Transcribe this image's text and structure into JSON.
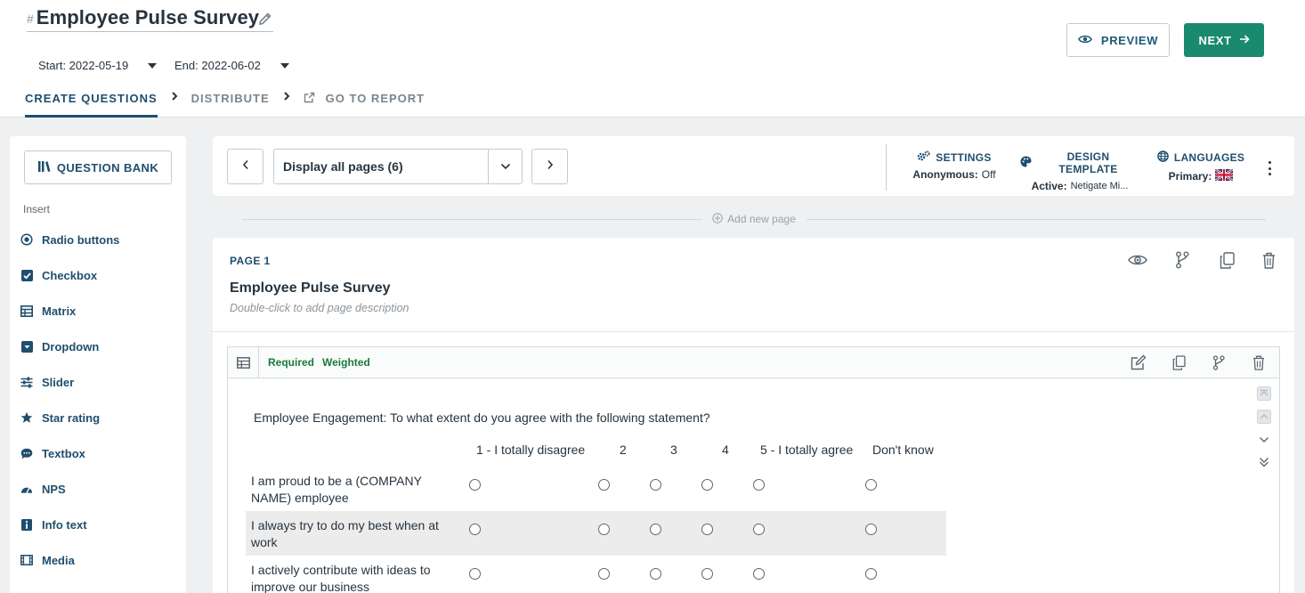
{
  "survey": {
    "hash": "#",
    "title": "Employee Pulse Survey"
  },
  "dates": {
    "start": "Start: 2022-05-19",
    "end": "End: 2022-06-02"
  },
  "actions": {
    "preview": "PREVIEW",
    "next": "NEXT"
  },
  "steps": [
    "CREATE QUESTIONS",
    "DISTRIBUTE",
    "GO TO REPORT"
  ],
  "left_panel": {
    "question_bank": "QUESTION BANK",
    "insert_label": "Insert",
    "items": [
      {
        "label": "Radio buttons",
        "icon": "radio-icon"
      },
      {
        "label": "Checkbox",
        "icon": "checkbox-icon"
      },
      {
        "label": "Matrix",
        "icon": "matrix-icon"
      },
      {
        "label": "Dropdown",
        "icon": "dropdown-icon"
      },
      {
        "label": "Slider",
        "icon": "slider-icon"
      },
      {
        "label": "Star rating",
        "icon": "star-icon"
      },
      {
        "label": "Textbox",
        "icon": "textbox-icon"
      },
      {
        "label": "NPS",
        "icon": "nps-icon"
      },
      {
        "label": "Info text",
        "icon": "info-icon"
      },
      {
        "label": "Media",
        "icon": "media-icon"
      }
    ]
  },
  "toolbar": {
    "page_select": "Display all pages (6)",
    "settings": {
      "label": "SETTINGS",
      "key": "Anonymous:",
      "value": "Off"
    },
    "design": {
      "label": "DESIGN TEMPLATE",
      "key": "Active:",
      "value": "Netigate Mi..."
    },
    "languages": {
      "label": "LANGUAGES",
      "key": "Primary:"
    }
  },
  "add_page": "Add new page",
  "page": {
    "number": "PAGE 1",
    "title": "Employee Pulse Survey",
    "description": "Double-click to add page description"
  },
  "question": {
    "tags": [
      "Required",
      "Weighted"
    ],
    "text": "Employee Engagement: To what extent do you agree with the following statement?",
    "columns": [
      "1 - I totally disagree",
      "2",
      "3",
      "4",
      "5 - I totally agree",
      "Don't know"
    ],
    "rows": [
      "I am proud to be a (COMPANY NAME) employee",
      "I always try to do my best when at work",
      "I actively contribute with ideas to improve our business"
    ]
  },
  "colors": {
    "accent": "#1f4e6e",
    "next": "#1a8a6e",
    "tag": "#1a7a3a"
  }
}
